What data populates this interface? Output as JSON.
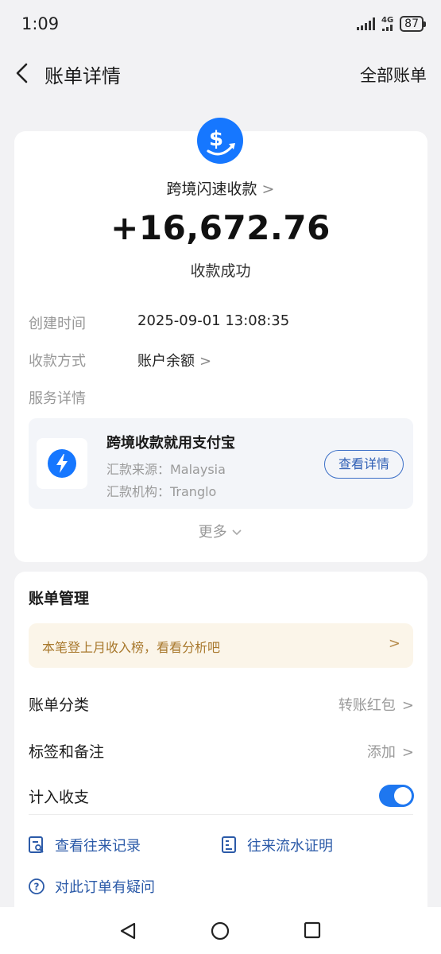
{
  "status_bar": {
    "time": "1:09",
    "network": "4G",
    "battery": "87"
  },
  "nav": {
    "title": "账单详情",
    "right_label": "全部账单"
  },
  "transaction": {
    "merchant": "跨境闪速收款",
    "amount": "+16,672.76",
    "status": "收款成功"
  },
  "details": [
    {
      "label": "创建时间",
      "value": "2025-09-01 13:08:35"
    },
    {
      "label": "收款方式",
      "value": "账户余额"
    },
    {
      "label": "服务详情",
      "value": ""
    }
  ],
  "service": {
    "title": "跨境收款就用支付宝",
    "source": "汇款来源：Malaysia",
    "institution": "汇款机构：Tranglo",
    "button": "查看详情"
  },
  "more_label": "更多",
  "management": {
    "title": "账单管理",
    "banner": "本笔登上月收入榜，看看分析吧",
    "rows": [
      {
        "label": "账单分类",
        "value": "转账红包"
      },
      {
        "label": "标签和备注",
        "value": "添加"
      },
      {
        "label": "计入收支",
        "value": ""
      }
    ],
    "toggle_on": true,
    "links": {
      "records": "查看往来记录",
      "statement": "往来流水证明",
      "question": "对此订单有疑问"
    }
  },
  "colors": {
    "accent": "#1e77f0",
    "link": "#2b5aa8",
    "banner_bg": "#fbf5e9",
    "banner_text": "#a8782c"
  }
}
